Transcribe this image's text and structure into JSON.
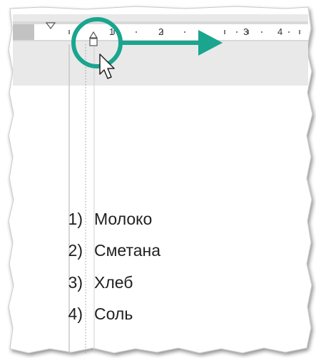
{
  "ruler": {
    "numbers": [
      "1",
      "2",
      "3",
      "4"
    ]
  },
  "list": {
    "items": [
      {
        "marker": "1)",
        "text": "Молоко"
      },
      {
        "marker": "2)",
        "text": "Сметана"
      },
      {
        "marker": "3)",
        "text": "Хлеб"
      },
      {
        "marker": "4)",
        "text": "Соль"
      }
    ]
  },
  "colors": {
    "accent": "#1aa58f",
    "ruler_band": "#e9e9e9",
    "page_background": "#ffffff",
    "text": "#1f1f1f"
  },
  "icons": {
    "indent_marker": "hanging-indent-icon",
    "first_line_marker": "first-line-indent-icon",
    "cursor": "mouse-pointer-icon",
    "arrow": "drag-direction-arrow-icon"
  }
}
